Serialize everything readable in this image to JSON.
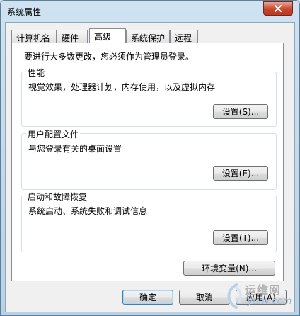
{
  "window": {
    "title": "系统属性"
  },
  "tabs": [
    {
      "label": "计算机名",
      "active": false
    },
    {
      "label": "硬件",
      "active": false
    },
    {
      "label": "高级",
      "active": true
    },
    {
      "label": "系统保护",
      "active": false
    },
    {
      "label": "远程",
      "active": false
    }
  ],
  "advanced": {
    "intro": "要进行大多数更改，您必须作为管理员登录。",
    "performance": {
      "title": "性能",
      "desc": "视觉效果，处理器计划，内存使用，以及虚拟内存",
      "button": "设置(S)..."
    },
    "profiles": {
      "title": "用户配置文件",
      "desc": "与您登录有关的桌面设置",
      "button": "设置(E)..."
    },
    "startup": {
      "title": "启动和故障恢复",
      "desc": "系统启动、系统失败和调试信息",
      "button": "设置(T)..."
    },
    "env_button": "环境变量(N)..."
  },
  "footer": {
    "ok": "确定",
    "cancel": "取消",
    "apply": "应用(A)"
  },
  "watermark": {
    "line1": "运维网",
    "line2": "iyunv.com"
  },
  "colors": {
    "close_button": "#c8442a",
    "default_button_border": "#3c7fb1"
  },
  "icons": {
    "close": "close-icon",
    "watermark_logo": "watermark-logo-icon"
  }
}
